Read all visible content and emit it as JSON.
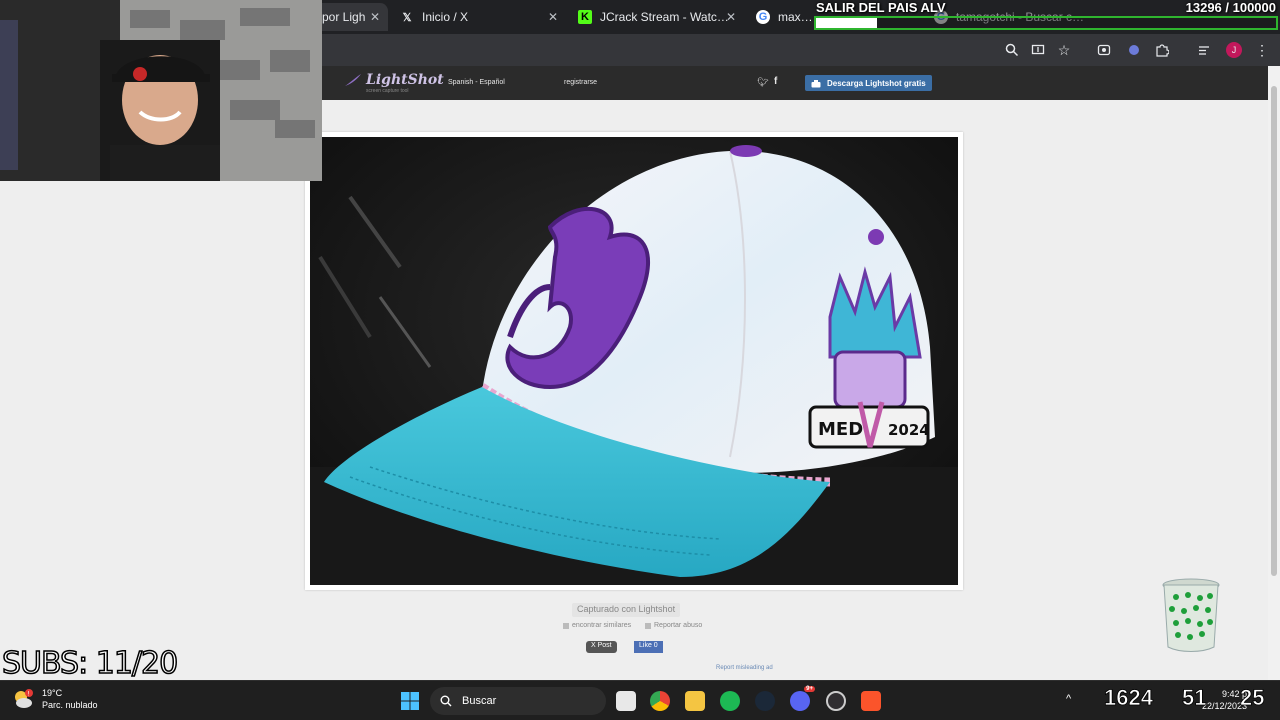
{
  "browser": {
    "tabs": [
      {
        "title": "por Ligh",
        "icon": "lightshot-favicon"
      },
      {
        "title": "Inicio / X",
        "icon": "x-logo-icon"
      },
      {
        "title": "JCrack Stream - Watch Live o",
        "icon": "kick-logo-icon"
      },
      {
        "title": "max steel",
        "icon": "google-g-icon"
      },
      {
        "title": "tamagotchi - Buscar con Go",
        "icon": "google-g-icon"
      }
    ],
    "toolbar_icons": [
      "zoom-icon",
      "install-app-icon",
      "bookmark-star-icon",
      "extension-puzzle-icon",
      "reading-list-icon",
      "profile-avatar-icon",
      "menu-kebab-icon"
    ],
    "profile_initial": "J"
  },
  "lightshot": {
    "logo": "LightShot",
    "tagline": "screen capture tool",
    "language": "Spanish - Español",
    "register": "registrarse",
    "download_button": "Descarga Lightshot gratis",
    "captured_label": "Capturado con Lightshot",
    "find_similar": "encontrar similares",
    "report_abuse": "Reportar abuso",
    "x_post": "X Post",
    "fb_like": "Like 0",
    "report_ad": "Report misleading ad"
  },
  "overlay": {
    "goal_label": "SALIR DEL PAIS ALV",
    "goal_count": "13296 / 100000",
    "goal_progress": 0.133,
    "subs_text": "SUBS: 11/20",
    "colors": {
      "goal_border": "#2fb52f",
      "goal_fill": "#ffffff"
    }
  },
  "cap_patch": {
    "text_left": "MED",
    "text_right": "2024"
  },
  "taskbar": {
    "temperature": "19°C",
    "weather": "Parc. nublado",
    "search_placeholder": "Buscar",
    "apps": [
      "windows-start-icon",
      "task-view-icon",
      "chrome-icon",
      "file-explorer-icon",
      "spotify-icon",
      "steam-icon",
      "discord-icon",
      "obs-icon",
      "brave-icon"
    ],
    "discord_badge": "9+",
    "big_clock_a": "1624",
    "big_clock_b": "51",
    "big_clock_c": "25",
    "time": "9:42 p",
    "date": "22/12/2023",
    "tray_caret": "^"
  }
}
